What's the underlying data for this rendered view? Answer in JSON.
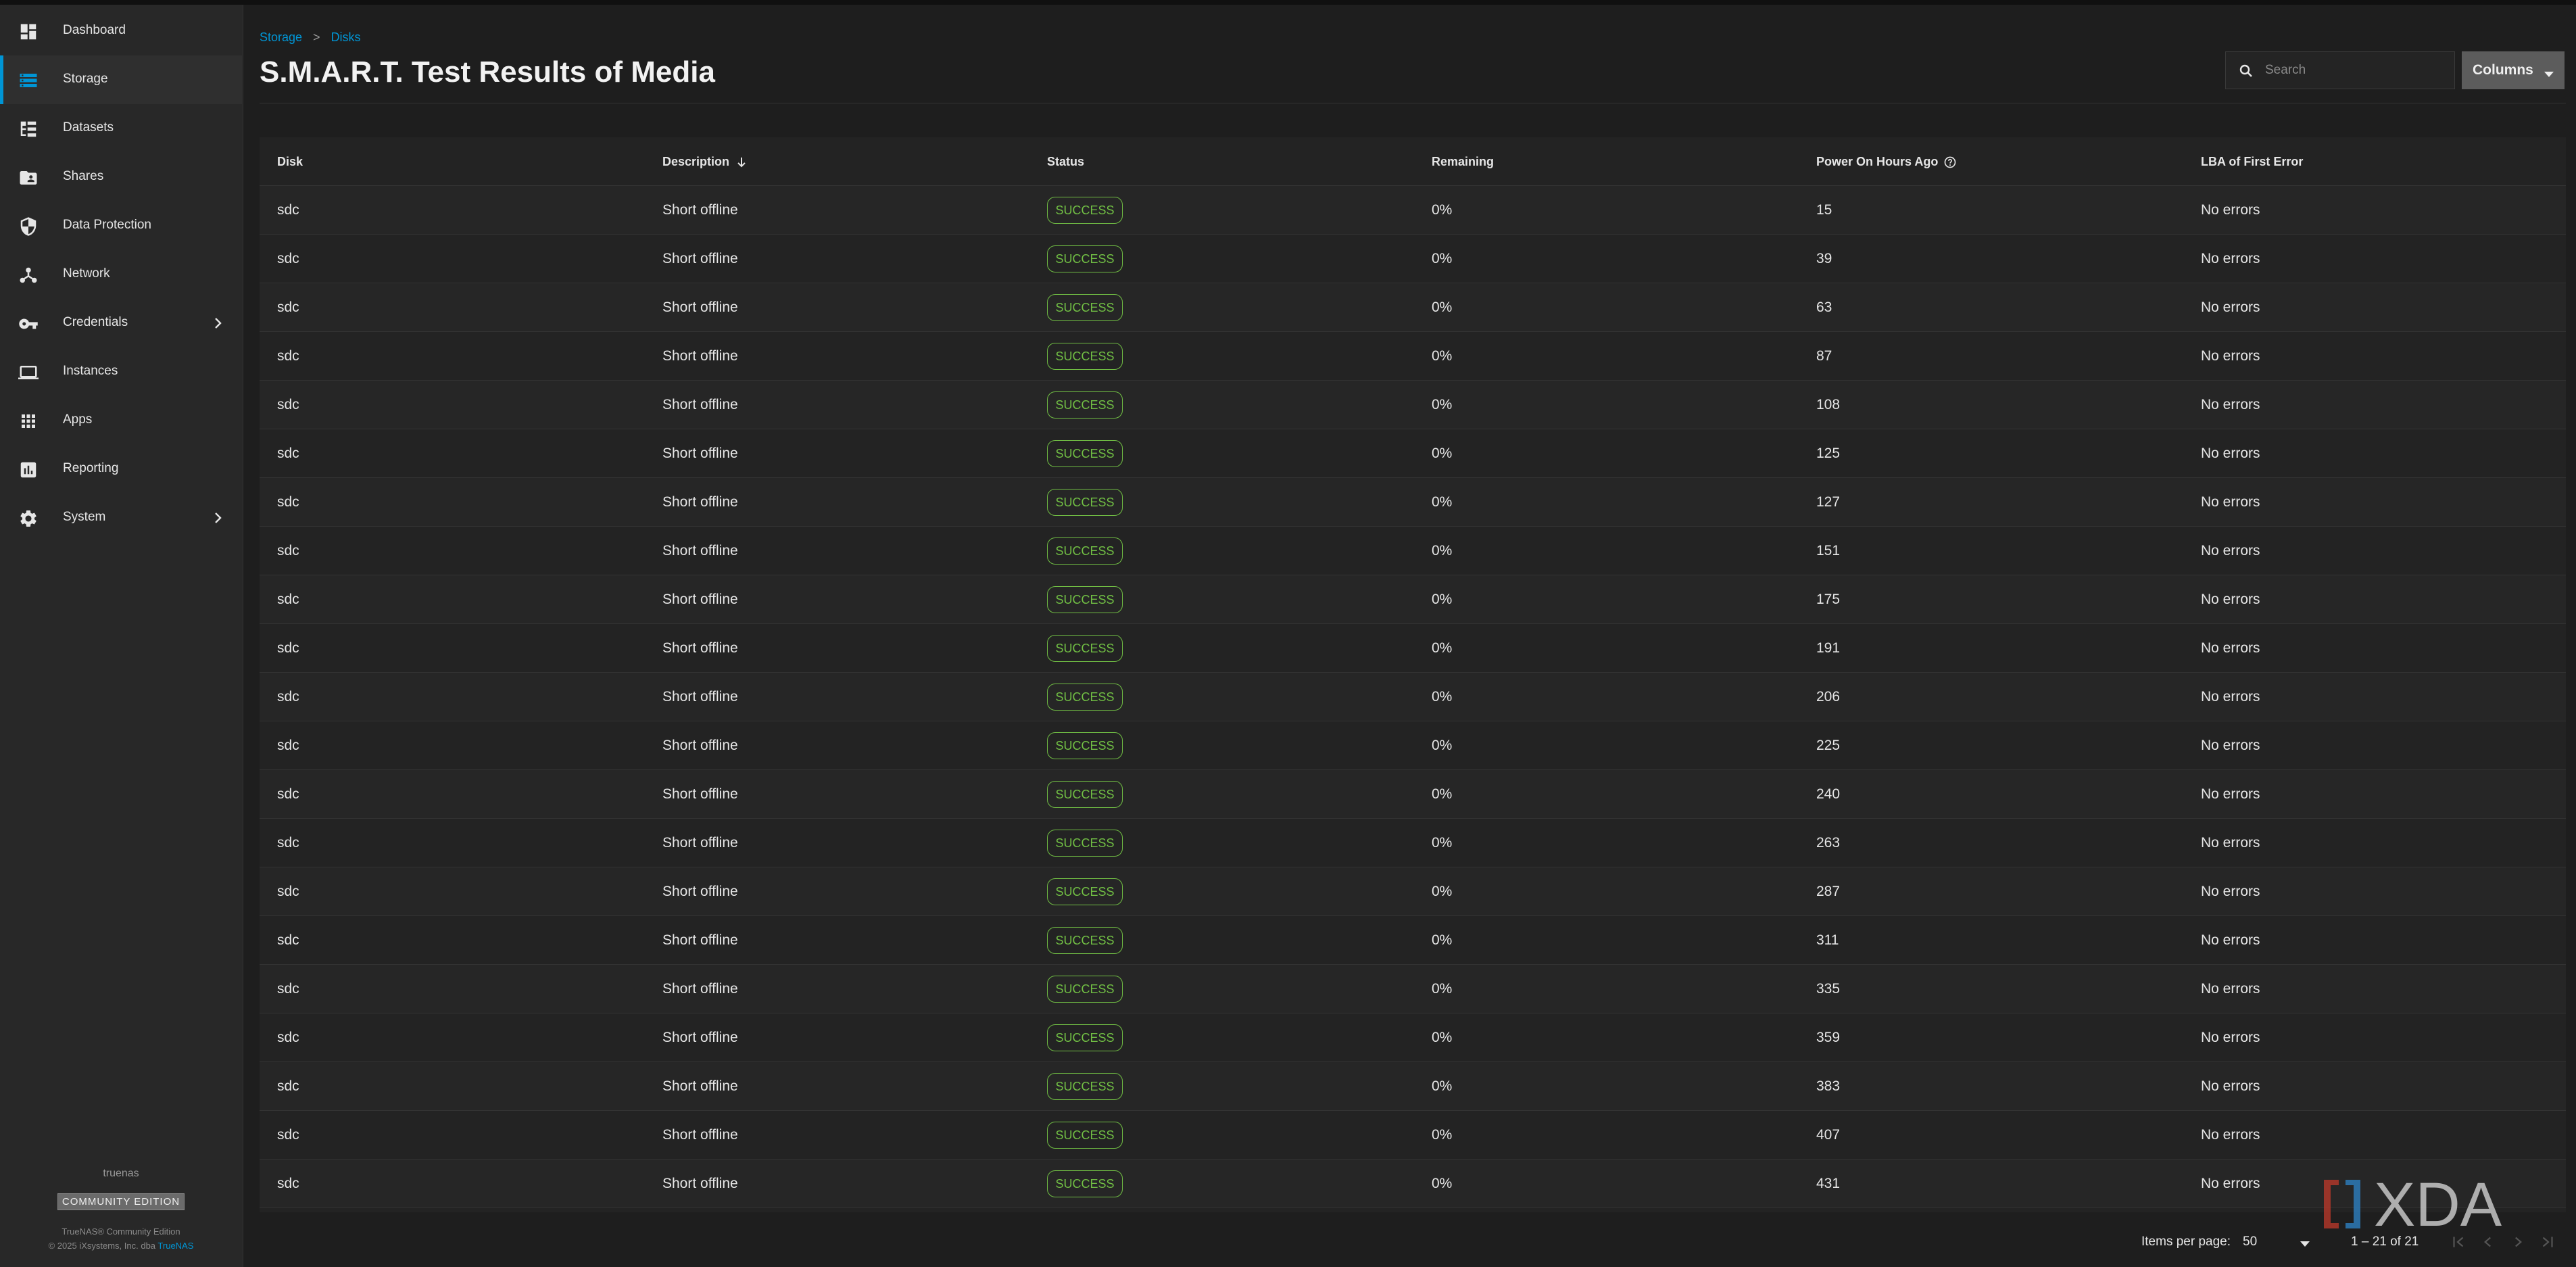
{
  "sidebar": {
    "items": [
      {
        "label": "Dashboard",
        "icon": "dashboard-icon"
      },
      {
        "label": "Storage",
        "icon": "storage-icon",
        "active": true
      },
      {
        "label": "Datasets",
        "icon": "datasets-icon"
      },
      {
        "label": "Shares",
        "icon": "shares-icon"
      },
      {
        "label": "Data Protection",
        "icon": "shield-icon"
      },
      {
        "label": "Network",
        "icon": "network-icon"
      },
      {
        "label": "Credentials",
        "icon": "key-icon",
        "expandable": true
      },
      {
        "label": "Instances",
        "icon": "laptop-icon"
      },
      {
        "label": "Apps",
        "icon": "apps-grid-icon"
      },
      {
        "label": "Reporting",
        "icon": "reporting-icon"
      },
      {
        "label": "System",
        "icon": "gear-icon",
        "expandable": true
      }
    ],
    "hostname": "truenas",
    "edition": "COMMUNITY EDITION",
    "copyright_line1": "TrueNAS® Community Edition",
    "copyright_line2": "© 2025 iXsystems, Inc. dba",
    "copyright_link": "TrueNAS"
  },
  "breadcrumb": {
    "items": [
      "Storage",
      "Disks"
    ],
    "separator": ">"
  },
  "page": {
    "title": "S.M.A.R.T. Test Results of Media"
  },
  "toolbar": {
    "search_placeholder": "Search",
    "columns_label": "Columns"
  },
  "table": {
    "headers": {
      "disk": "Disk",
      "description": "Description",
      "status": "Status",
      "remaining": "Remaining",
      "power_on_hours": "Power On Hours Ago",
      "lba": "LBA of First Error"
    },
    "sort": {
      "column": "description",
      "direction": "ascending"
    },
    "rows": [
      {
        "disk": "sdc",
        "description": "Short offline",
        "status": "SUCCESS",
        "remaining": "0%",
        "hours": "15",
        "lba": "No errors"
      },
      {
        "disk": "sdc",
        "description": "Short offline",
        "status": "SUCCESS",
        "remaining": "0%",
        "hours": "39",
        "lba": "No errors"
      },
      {
        "disk": "sdc",
        "description": "Short offline",
        "status": "SUCCESS",
        "remaining": "0%",
        "hours": "63",
        "lba": "No errors"
      },
      {
        "disk": "sdc",
        "description": "Short offline",
        "status": "SUCCESS",
        "remaining": "0%",
        "hours": "87",
        "lba": "No errors"
      },
      {
        "disk": "sdc",
        "description": "Short offline",
        "status": "SUCCESS",
        "remaining": "0%",
        "hours": "108",
        "lba": "No errors"
      },
      {
        "disk": "sdc",
        "description": "Short offline",
        "status": "SUCCESS",
        "remaining": "0%",
        "hours": "125",
        "lba": "No errors"
      },
      {
        "disk": "sdc",
        "description": "Short offline",
        "status": "SUCCESS",
        "remaining": "0%",
        "hours": "127",
        "lba": "No errors"
      },
      {
        "disk": "sdc",
        "description": "Short offline",
        "status": "SUCCESS",
        "remaining": "0%",
        "hours": "151",
        "lba": "No errors"
      },
      {
        "disk": "sdc",
        "description": "Short offline",
        "status": "SUCCESS",
        "remaining": "0%",
        "hours": "175",
        "lba": "No errors"
      },
      {
        "disk": "sdc",
        "description": "Short offline",
        "status": "SUCCESS",
        "remaining": "0%",
        "hours": "191",
        "lba": "No errors"
      },
      {
        "disk": "sdc",
        "description": "Short offline",
        "status": "SUCCESS",
        "remaining": "0%",
        "hours": "206",
        "lba": "No errors"
      },
      {
        "disk": "sdc",
        "description": "Short offline",
        "status": "SUCCESS",
        "remaining": "0%",
        "hours": "225",
        "lba": "No errors"
      },
      {
        "disk": "sdc",
        "description": "Short offline",
        "status": "SUCCESS",
        "remaining": "0%",
        "hours": "240",
        "lba": "No errors"
      },
      {
        "disk": "sdc",
        "description": "Short offline",
        "status": "SUCCESS",
        "remaining": "0%",
        "hours": "263",
        "lba": "No errors"
      },
      {
        "disk": "sdc",
        "description": "Short offline",
        "status": "SUCCESS",
        "remaining": "0%",
        "hours": "287",
        "lba": "No errors"
      },
      {
        "disk": "sdc",
        "description": "Short offline",
        "status": "SUCCESS",
        "remaining": "0%",
        "hours": "311",
        "lba": "No errors"
      },
      {
        "disk": "sdc",
        "description": "Short offline",
        "status": "SUCCESS",
        "remaining": "0%",
        "hours": "335",
        "lba": "No errors"
      },
      {
        "disk": "sdc",
        "description": "Short offline",
        "status": "SUCCESS",
        "remaining": "0%",
        "hours": "359",
        "lba": "No errors"
      },
      {
        "disk": "sdc",
        "description": "Short offline",
        "status": "SUCCESS",
        "remaining": "0%",
        "hours": "383",
        "lba": "No errors"
      },
      {
        "disk": "sdc",
        "description": "Short offline",
        "status": "SUCCESS",
        "remaining": "0%",
        "hours": "407",
        "lba": "No errors"
      },
      {
        "disk": "sdc",
        "description": "Short offline",
        "status": "SUCCESS",
        "remaining": "0%",
        "hours": "431",
        "lba": "No errors"
      }
    ]
  },
  "pagination": {
    "items_per_page_label": "Items per page:",
    "items_per_page_value": "50",
    "range_label": "1 – 21 of 21"
  },
  "watermark": {
    "text": "XDA"
  },
  "colors": {
    "accent": "#0095d5",
    "success": "#71bf44",
    "background": "#1e1e1e",
    "sidebar": "#282828"
  }
}
